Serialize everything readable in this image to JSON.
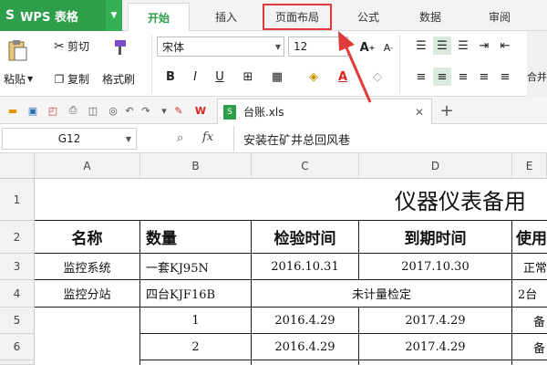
{
  "app": {
    "name": "WPS 表格",
    "logo": "S"
  },
  "tabs": [
    "开始",
    "插入",
    "页面布局",
    "公式",
    "数据",
    "审阅"
  ],
  "ribbon": {
    "cut": "剪切",
    "paste": "粘贴",
    "copy": "复制",
    "format_painter": "格式刷",
    "font_name": "宋体",
    "font_size": "12",
    "merge_label": "合并"
  },
  "document": {
    "tab_name": "台账.xls"
  },
  "formula_bar": {
    "cell_ref": "G12",
    "fx": "fx",
    "content": "安装在矿井总回风巷"
  },
  "columns": [
    "A",
    "B",
    "C",
    "D",
    "E"
  ],
  "rows": [
    "1",
    "2",
    "3",
    "4",
    "5",
    "6"
  ],
  "sheet": {
    "title": "仪器仪表备用",
    "headers": [
      "名称",
      "数量",
      "检验时间",
      "到期时间",
      "使用"
    ],
    "r3": [
      "监控系统",
      "一套KJ95N",
      "2016.10.31",
      "2017.10.30",
      "正常"
    ],
    "r4": [
      "监控分站",
      "四台KJF16B",
      "未计量检定",
      "2台"
    ],
    "r5": [
      "1",
      "2016.4.29",
      "2017.4.29",
      "备"
    ],
    "r6": [
      "2",
      "2016.4.29",
      "2017.4.29",
      "备"
    ]
  }
}
